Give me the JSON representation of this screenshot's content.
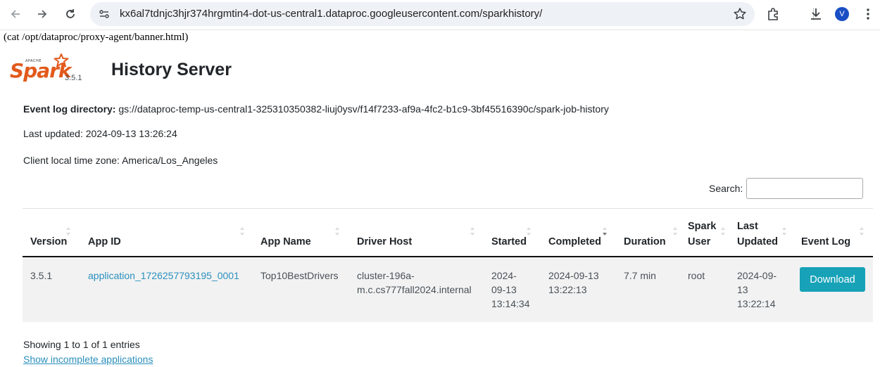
{
  "browser": {
    "url": "kx6al7tdnjc3hjr374hrgmtin4-dot-us-central1.dataproc.googleusercontent.com/sparkhistory/",
    "avatar_letter": "V"
  },
  "banner": "(cat /opt/dataproc/proxy-agent/banner.html)",
  "header": {
    "logo_text": "Spark",
    "logo_apache": "APACHE",
    "version": "3.5.1",
    "title": "History Server"
  },
  "info": {
    "event_log_label": "Event log directory:",
    "event_log_value": " gs://dataproc-temp-us-central1-325310350382-liuj0ysv/f14f7233-af9a-4fc2-b1c9-3bf45516390c/spark-job-history",
    "last_updated": "Last updated: 2024-09-13 13:26:24",
    "time_zone": "Client local time zone: America/Los_Angeles"
  },
  "search": {
    "label": "Search:",
    "value": ""
  },
  "table": {
    "headers": {
      "version": "Version",
      "app_id": "App ID",
      "app_name": "App Name",
      "driver_host": "Driver Host",
      "started": "Started",
      "completed": "Completed",
      "duration": "Duration",
      "spark_user_1": "Spark",
      "spark_user_2": "User",
      "last_updated_1": "Last",
      "last_updated_2": "Updated",
      "event_log": "Event Log"
    },
    "row": {
      "version": "3.5.1",
      "app_id": "application_1726257793195_0001",
      "app_name": "Top10BestDrivers",
      "driver_host_1": "cluster-196a-",
      "driver_host_2": "m.c.cs777fall2024.internal",
      "started_1": "2024-",
      "started_2": "09-13",
      "started_3": "13:14:34",
      "completed_1": "2024-09-13",
      "completed_2": "13:22:13",
      "duration": "7.7 min",
      "spark_user": "root",
      "last_updated_1": "2024-09-",
      "last_updated_2": "13",
      "last_updated_3": "13:22:14",
      "download_label": "Download"
    }
  },
  "footer": {
    "showing": "Showing 1 to 1 of 1 entries",
    "incomplete_link": "Show incomplete applications"
  },
  "colors": {
    "spark_orange": "#e25a1c",
    "link": "#2a8fbd",
    "button": "#17a2b8"
  }
}
